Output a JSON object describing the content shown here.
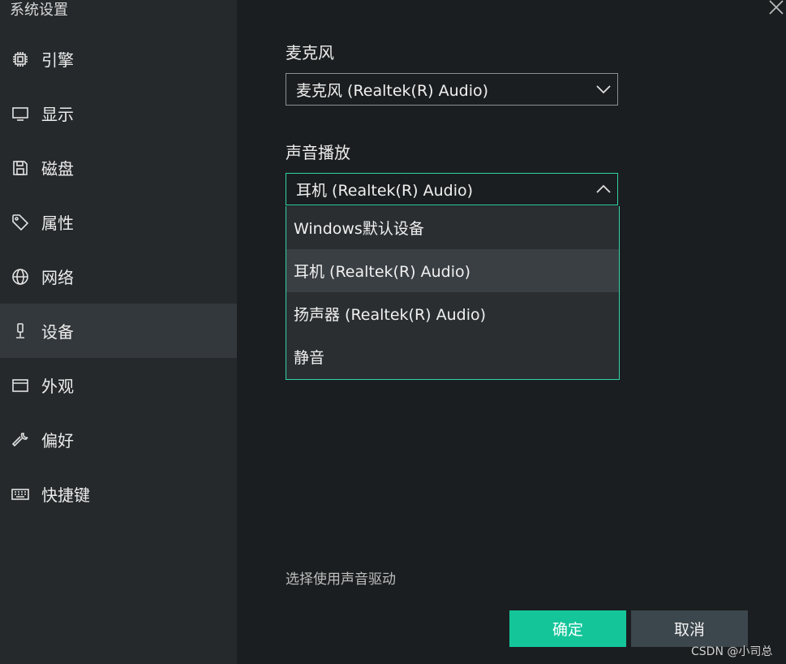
{
  "window": {
    "title": "系统设置"
  },
  "sidebar": {
    "items": [
      {
        "label": "引擎",
        "icon": "chip-icon"
      },
      {
        "label": "显示",
        "icon": "monitor-icon"
      },
      {
        "label": "磁盘",
        "icon": "disk-icon"
      },
      {
        "label": "属性",
        "icon": "tag-icon"
      },
      {
        "label": "网络",
        "icon": "globe-icon"
      },
      {
        "label": "设备",
        "icon": "microphone-icon",
        "active": true
      },
      {
        "label": "外观",
        "icon": "window-icon"
      },
      {
        "label": "偏好",
        "icon": "wrench-icon"
      },
      {
        "label": "快捷键",
        "icon": "keyboard-icon"
      }
    ]
  },
  "main": {
    "microphone": {
      "label": "麦克风",
      "value": "麦克风 (Realtek(R) Audio)"
    },
    "playback": {
      "label": "声音播放",
      "value": "耳机 (Realtek(R) Audio)",
      "options": [
        "Windows默认设备",
        "耳机 (Realtek(R) Audio)",
        "扬声器 (Realtek(R) Audio)",
        "静音"
      ],
      "highlighted_index": 1
    },
    "hint": "选择使用声音驱动"
  },
  "footer": {
    "ok_label": "确定",
    "cancel_label": "取消"
  },
  "watermark": "CSDN @小司总",
  "colors": {
    "accent": "#14c59a",
    "sidebar_bg": "#25292c",
    "main_bg": "#1b1e20",
    "focus_border": "#2fd3a8"
  }
}
